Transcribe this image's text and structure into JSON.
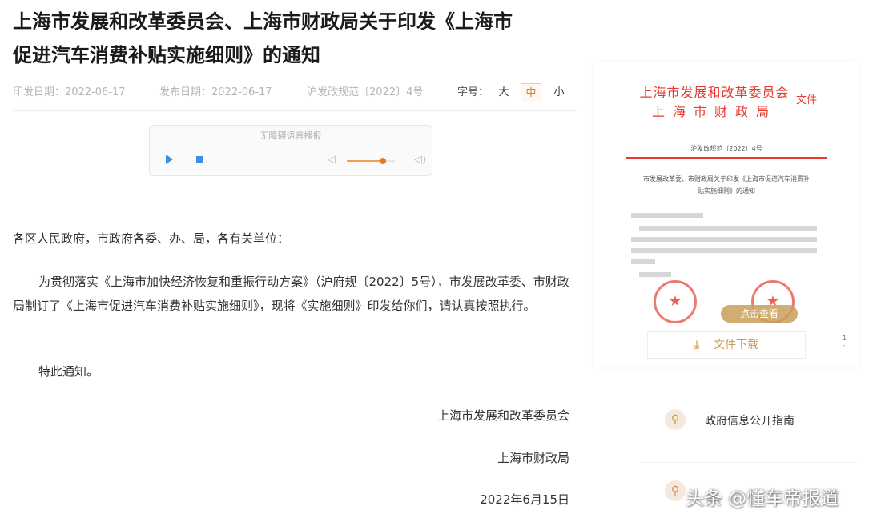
{
  "article": {
    "title_line1": "上海市发展和改革委员会、上海市财政局关于印发《上海市",
    "title_line2": "促进汽车消费补贴实施细则》的通知",
    "meta": {
      "issue_date": "印发日期：2022-06-17",
      "publish_date": "发布日期：2022-06-17",
      "doc_number": "沪发改规范〔2022〕4号"
    },
    "font_size": {
      "label": "字号：",
      "large": "大",
      "medium": "中",
      "small": "小"
    },
    "audio": {
      "title": "无障碍语音播报",
      "volume_level": 0.75
    },
    "addressee": "各区人民政府，市政府各委、办、局，各有关单位：",
    "body": "为贯彻落实《上海市加快经济恢复和重振行动方案》（沪府规〔2022〕5号），市发展改革委、市财政局制订了《上海市促进汽车消费补贴实施细则》，现将《实施细则》印发给你们，请认真按照执行。",
    "closing": "特此通知。",
    "signature1": "上海市发展和改革委员会",
    "signature2": "上海市财政局",
    "signature_date": "2022年6月15日"
  },
  "preview": {
    "head1": "上海市发展和改革委员会",
    "head2": "上海市财政局",
    "wen": "文件",
    "doc_number": "沪发改规范〔2022〕4号",
    "subtitle": "市发展改革委、市财政局关于印发《上海市促进汽车消费补贴实施细则》的通知",
    "click_view": "点击查看",
    "page_num": "- 1 -",
    "download": "文件下载"
  },
  "sidebar": {
    "items": [
      {
        "label": "政府信息公开指南"
      }
    ]
  },
  "watermark": "头条 @懂车帝报道",
  "colors": {
    "accent": "#e27d22",
    "red_head": "#e83a2e",
    "player_blue": "#3b8fe6"
  }
}
